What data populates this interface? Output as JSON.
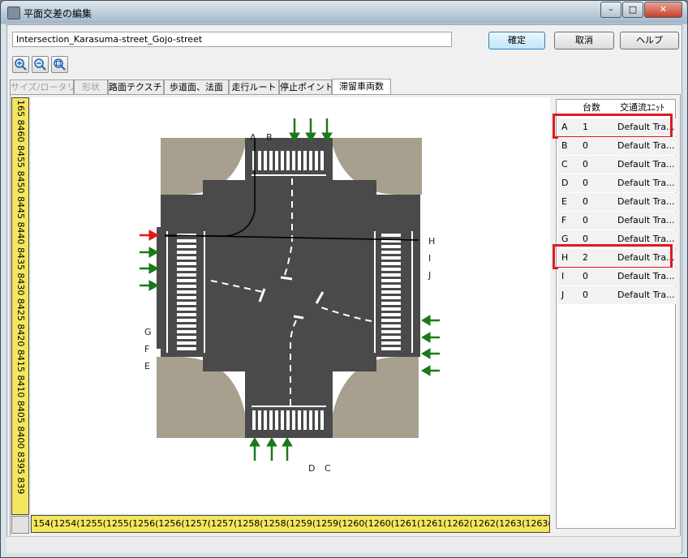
{
  "window": {
    "title": "平面交差の編集"
  },
  "controls": {
    "minimize": "–",
    "maximize": "□",
    "close": "✕"
  },
  "name_field": {
    "value": "Intersection_Karasuma-street_Gojo-street"
  },
  "buttons": {
    "ok": "確定",
    "cancel": "取消",
    "help": "ヘルプ"
  },
  "zoom_icons": [
    "zoom-in-icon",
    "zoom-out-icon",
    "zoom-fit-icon"
  ],
  "tabs": [
    {
      "label": "サイズ/ロータリー",
      "state": "disabled"
    },
    {
      "label": "形状",
      "state": "disabled"
    },
    {
      "label": "路面テクスチャ",
      "state": "normal"
    },
    {
      "label": "歩道面、法面",
      "state": "normal"
    },
    {
      "label": "走行ルート",
      "state": "normal"
    },
    {
      "label": "停止ポイント",
      "state": "normal"
    },
    {
      "label": "滞留車両数",
      "state": "active"
    }
  ],
  "ruler": {
    "vertical": "165 8460 8455 8450 8445 8440 8435 8430 8425 8420 8415 8410 8405 8400 8395 839",
    "horizontal": "154(1254(1255(1255(1256(1256(1257(1257(1258(1258(1259(1259(1260(1260(1261(1261(1262(1262(1263(1263("
  },
  "map": {
    "labels": {
      "A": "A",
      "B": "B",
      "C": "C",
      "D": "D",
      "E": "E",
      "F": "F",
      "G": "G",
      "H": "H",
      "I": "I",
      "J": "J"
    },
    "colors": {
      "road": "#4a4a4a",
      "sidewalk": "#a7a08f",
      "arrow_green": "#1a7a1a",
      "arrow_red": "#e01818"
    }
  },
  "table": {
    "headers": {
      "col1": "",
      "col2": "台数",
      "col3": "交通流ﾕﾆｯﾄ"
    },
    "rows": [
      {
        "id": "A",
        "count": "1",
        "unit": "Default Tra...",
        "highlight": true
      },
      {
        "id": "B",
        "count": "0",
        "unit": "Default Tra...",
        "highlight": false
      },
      {
        "id": "C",
        "count": "0",
        "unit": "Default Tra...",
        "highlight": false
      },
      {
        "id": "D",
        "count": "0",
        "unit": "Default Tra...",
        "highlight": false
      },
      {
        "id": "E",
        "count": "0",
        "unit": "Default Tra...",
        "highlight": false
      },
      {
        "id": "F",
        "count": "0",
        "unit": "Default Tra...",
        "highlight": false
      },
      {
        "id": "G",
        "count": "0",
        "unit": "Default Tra...",
        "highlight": false
      },
      {
        "id": "H",
        "count": "2",
        "unit": "Default Tra...",
        "highlight": true
      },
      {
        "id": "I",
        "count": "0",
        "unit": "Default Tra...",
        "highlight": false
      },
      {
        "id": "J",
        "count": "0",
        "unit": "Default Tra...",
        "highlight": false
      }
    ]
  }
}
